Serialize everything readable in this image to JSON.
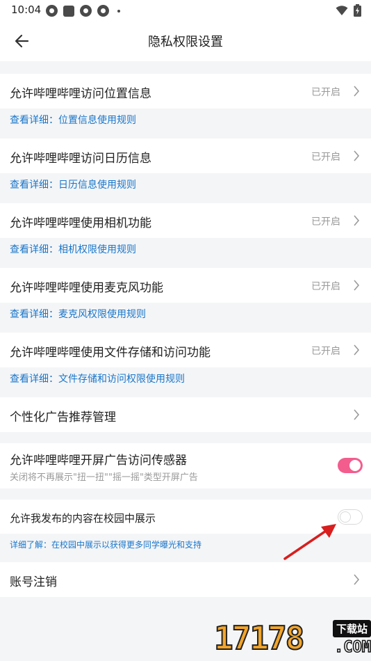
{
  "statusbar": {
    "time": "10:04"
  },
  "header": {
    "title": "隐私权限设置"
  },
  "permissions": [
    {
      "title": "允许哔哩哔哩访问位置信息",
      "status": "已开启",
      "link": "查看详细：位置信息使用规则"
    },
    {
      "title": "允许哔哩哔哩访问日历信息",
      "status": "已开启",
      "link": "查看详细：日历信息使用规则"
    },
    {
      "title": "允许哔哩哔哩使用相机功能",
      "status": "已开启",
      "link": "查看详细：相机权限使用规则"
    },
    {
      "title": "允许哔哩哔哩使用麦克风功能",
      "status": "已开启",
      "link": "查看详细：麦克风权限使用规则"
    },
    {
      "title": "允许哔哩哔哩使用文件存储和访问功能",
      "status": "已开启",
      "link": "查看详细：文件存储和访问权限使用规则"
    }
  ],
  "ads": {
    "title": "个性化广告推荐管理"
  },
  "sensor": {
    "title": "允许哔哩哔哩开屏广告访问传感器",
    "subtitle": "关闭将不再展示\"扭一扭\"\"摇一摇\"类型开屏广告",
    "enabled": true
  },
  "campus": {
    "title": "允许我发布的内容在校园中展示",
    "link": "详细了解：在校园中展示以获得更多同学曝光和支持",
    "enabled": false
  },
  "account": {
    "title": "账号注销"
  },
  "watermark": {
    "number": "17178",
    "badge": "下载站",
    "domain": ".COM"
  },
  "colors": {
    "link": "#1976c9",
    "toggle_on": "#f25d8e",
    "arrow": "#d81e1e"
  }
}
